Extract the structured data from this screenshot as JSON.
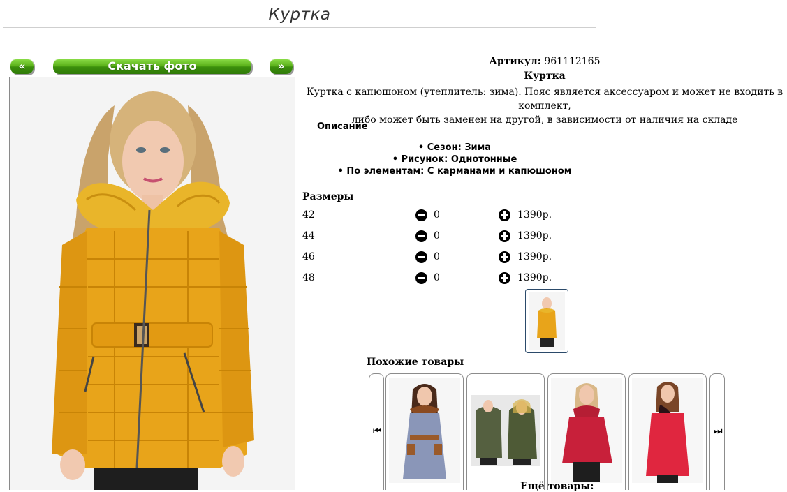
{
  "page": {
    "title": "Куртка"
  },
  "gallery": {
    "prev_label": "«",
    "download_label": "Скачать фото",
    "next_label": "»"
  },
  "product": {
    "article_label": "Артикул:",
    "article": "961112165",
    "name": "Куртка",
    "description_line1": "Куртка с капюшоном (утеплитель: зима). Пояс является аксессуаром и может не входить в комплект,",
    "description_line2": "либо может быть заменен на другой, в зависимости от наличия на складе",
    "features_title": "Описание",
    "features": [
      "Сезон: Зима",
      "Рисунок: Однотонные",
      "По элементам: С карманами и капюшоном"
    ]
  },
  "sizes": {
    "title": "Размеры",
    "rows": [
      {
        "size": "42",
        "qty": "0",
        "price": "1390р."
      },
      {
        "size": "44",
        "qty": "0",
        "price": "1390р."
      },
      {
        "size": "46",
        "qty": "0",
        "price": "1390р."
      },
      {
        "size": "48",
        "qty": "0",
        "price": "1390р."
      }
    ]
  },
  "similar": {
    "title": "Похожие товары",
    "prev_glyph": "⏮",
    "next_glyph": "⏭"
  },
  "more": {
    "title": "Ещё товары:"
  },
  "colors": {
    "button_green": "#5db31c",
    "jacket_mustard": "#e8a41a",
    "fur_yellow": "#e9b52a"
  }
}
